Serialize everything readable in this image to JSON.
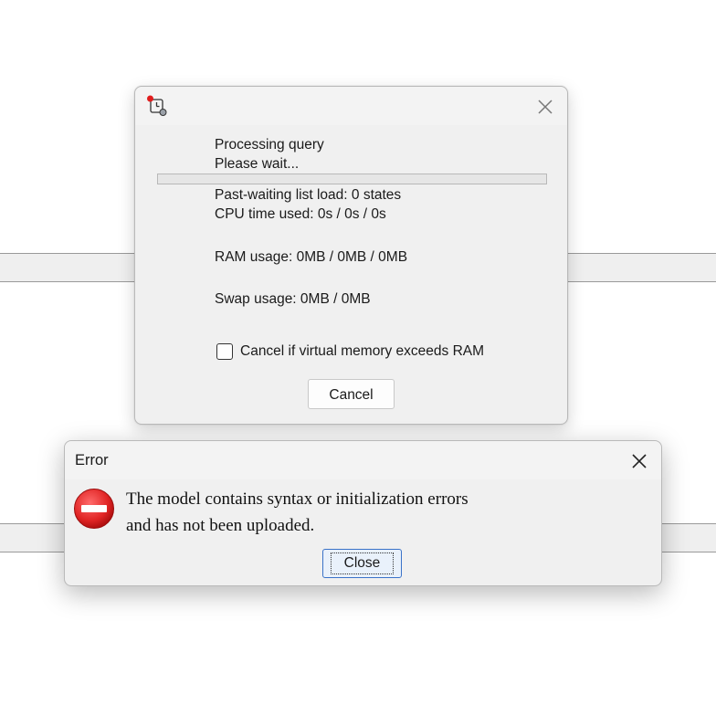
{
  "progress_dialog": {
    "line1": "Processing query",
    "line2": "Please wait...",
    "progress": 0,
    "past_waiting": "Past-waiting list load: 0 states",
    "cpu_time": "CPU time used: 0s / 0s / 0s",
    "ram_usage": "RAM usage: 0MB / 0MB / 0MB",
    "swap_usage": "Swap usage: 0MB / 0MB",
    "checkbox_label": "Cancel if virtual memory exceeds RAM",
    "checkbox_checked": false,
    "cancel_label": "Cancel"
  },
  "error_dialog": {
    "title": "Error",
    "message_line1": "The model contains syntax or initialization errors",
    "message_line2": "and has not been uploaded.",
    "close_label": "Close"
  },
  "colors": {
    "error_icon": "#e02424",
    "focus_border": "#3a72c8"
  },
  "icons": {
    "app": "uppaal-clock-icon",
    "error": "error-stop-icon",
    "close": "close-icon"
  }
}
